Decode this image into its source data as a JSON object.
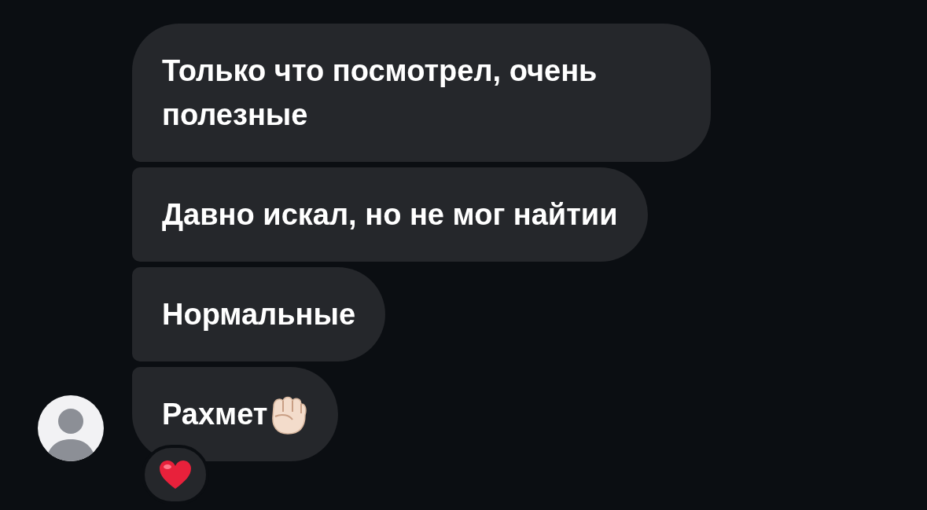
{
  "messages": [
    {
      "kind": "text",
      "text": "Только что посмотрел, очень полезные"
    },
    {
      "kind": "text",
      "text": "Давно искал, но не мог найтии"
    },
    {
      "kind": "text",
      "text": "Нормальные"
    },
    {
      "kind": "gesture",
      "text": "Рахмет",
      "reacted": true
    }
  ]
}
